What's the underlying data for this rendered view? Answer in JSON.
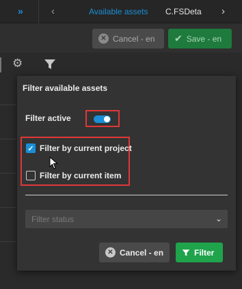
{
  "topbar": {
    "collapse_glyph": "»",
    "back_glyph": "‹",
    "forward_glyph": "›",
    "tabs": [
      {
        "label": "Available assets"
      },
      {
        "label": "C.FSDeta"
      }
    ]
  },
  "actions": {
    "cancel_label": "Cancel - en",
    "save_label": "Save - en"
  },
  "toolbar": {
    "settings_icon": "gear-icon",
    "filter_icon": "funnel-icon"
  },
  "filter_panel": {
    "title": "Filter available assets",
    "filter_active_label": "Filter active",
    "filter_active": true,
    "by_project_label": "Filter by current project",
    "by_project_checked": true,
    "by_item_label": "Filter by current item",
    "by_item_checked": false,
    "status_placeholder": "Filter status",
    "cancel_label": "Cancel - en",
    "filter_label": "Filter"
  },
  "colors": {
    "accent_blue": "#1a8fd6",
    "success_green": "#1fa34b",
    "highlight_red": "#e03838",
    "panel_bg": "#333333"
  }
}
